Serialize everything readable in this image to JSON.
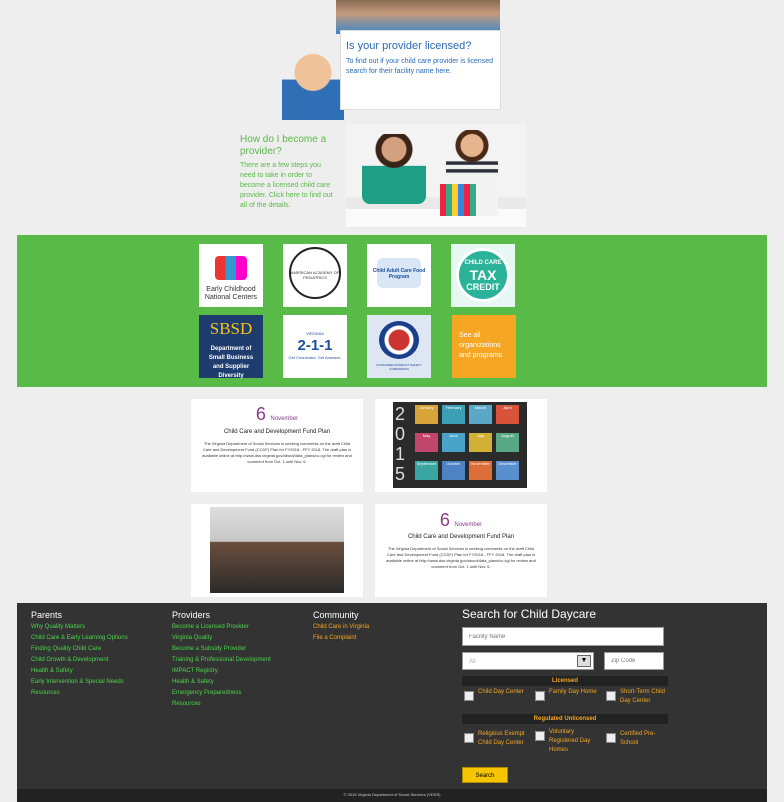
{
  "hero": {
    "licensed_title": "Is your provider licensed?",
    "licensed_text": "To find out if your child care provider is licensed search for their facility name here.",
    "provider_title": "How do I become a provider?",
    "provider_text": "There are a few steps you need to take in order to become a licensed child care provider. Click here to find out all of the details."
  },
  "partners": {
    "logos": [
      {
        "name": "Early Childhood National Centers"
      },
      {
        "name": "American Academy of Pediatrics"
      },
      {
        "name": "Child and Adult Care Food Program"
      },
      {
        "name": "Child Care Tax Credit"
      },
      {
        "name": "SBSD Department of Small Business and Supplier Diversity"
      },
      {
        "name": "Virginia 2-1-1 Get Connected. Get Answers."
      },
      {
        "name": "Consumer Product Safety Commission"
      }
    ],
    "see_all": "See all organizations and programs",
    "logo_text": {
      "ecnc": "Early Childhood National Centers",
      "aap": "AMERICAN ACADEMY OF PEDIATRICS",
      "cacfp": "Child Adult Care Food Program",
      "tax1": "CHILD CARE",
      "tax2": "TAX",
      "tax3": "CREDIT",
      "sbsd1": "SBSD",
      "sbsd2": "Department of Small Business and Supplier Diversity",
      "va": "VIRGINIA",
      "num": "2-1-1",
      "tag": "Get Connected. Get Answers.",
      "cpsc": "CONSUMER PRODUCT SAFETY COMMISSION"
    }
  },
  "news": [
    {
      "day": "6",
      "month": "November",
      "title": "Child Care and Development Fund Plan",
      "body": "The Virginia Department of Social Services is seeking comments on the draft Child Care and Development Fund (CCDF) Plan for FY2016 - FFY 2018. The draft plan is available online at http://www.dss.virginia.gov/about/data_plans/cc.cgi for review and comment from Oct. 1 until Nov. 6."
    },
    {
      "day": "6",
      "month": "November",
      "title": "Child Care and Development Fund Plan",
      "body": "The Virginia Department of Social Services is seeking comments on the draft Child Care and Development Fund (CCDF) Plan for FY2016 - FFY 2018. The draft plan is available online at http://www.dss.virginia.gov/about/data_plans/cc.cgi for review and comment from Oct. 1 until Nov. 6."
    }
  ],
  "calendar": {
    "year": "2015",
    "months": [
      "January",
      "February",
      "March",
      "April",
      "May",
      "June",
      "July",
      "August",
      "September",
      "October",
      "November",
      "December"
    ]
  },
  "footer": {
    "parents_heading": "Parents",
    "parents_links": [
      "Why Quality Matters",
      "Child Care & Early Learning Options",
      "Finding Quality Child Care",
      "Child Growth & Development",
      "Health & Safety",
      "Early Intervention & Special Needs",
      "Resources"
    ],
    "providers_heading": "Providers",
    "providers_links": [
      "Become a Licensed Provider",
      "Virginia Quality",
      "Become a Subsidy Provider",
      "Training & Professional Development",
      "IMPACT Registry",
      "Health & Safety",
      "Emergency Preparedness",
      "Resources"
    ],
    "community_heading": "Community",
    "community_links": [
      "Child Care in Virginia",
      "File a Complaint"
    ],
    "search": {
      "heading": "Search for Child Daycare",
      "facility_placeholder": "Facility Name",
      "select_value": "All",
      "zip_placeholder": "Zip Code",
      "licensed_heading": "Licensed",
      "licensed_options": [
        "Child Day Center",
        "Family Day Home",
        "Short-Term Child Day Center"
      ],
      "unlicensed_heading": "Regulated Unlicensed",
      "unlicensed_options": [
        "Religious Exempt Child Day Center",
        "Voluntary Registered Day Homes",
        "Certified Pre-School"
      ],
      "button": "Search"
    },
    "copyright": "© 2015 Virginia Department of Social Services (VDSS)"
  }
}
